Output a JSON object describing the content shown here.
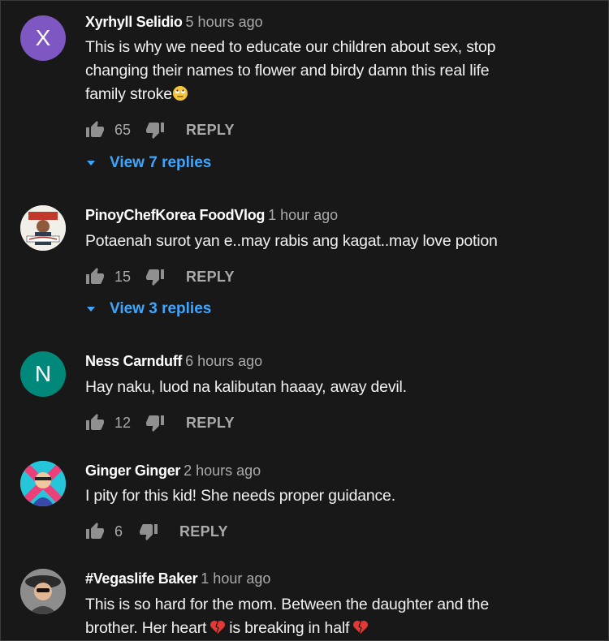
{
  "colors": {
    "background": "#181818",
    "link": "#3ea6ff",
    "meta": "#aaaaaa",
    "text": "#f1f1f1"
  },
  "reply_label": "REPLY",
  "comments": [
    {
      "author": "Xyrhyll Selidio",
      "time": "5 hours ago",
      "avatar_letter": "X",
      "avatar_color": "#7e57c2",
      "text_lines": [
        "This is why we need to educate our children about sex, stop",
        "changing their names to flower and birdy damn this real life",
        "family stroke"
      ],
      "text_end_icon": "eye-roll-emoji-icon",
      "likes": "65",
      "replies": "View 7 replies"
    },
    {
      "author": "PinoyChefKorea FoodVlog",
      "time": "1 hour ago",
      "avatar_icon": "channel-photo",
      "text_lines": [
        "Potaenah surot yan e..may rabis ang kagat..may love potion"
      ],
      "likes": "15",
      "replies": "View 3 replies"
    },
    {
      "author": "Ness Carnduff",
      "time": "6 hours ago",
      "avatar_letter": "N",
      "avatar_color": "#00897b",
      "text_lines": [
        "Hay naku, luod na kalibutan haaay, away devil."
      ],
      "likes": "12"
    },
    {
      "author": "Ginger Ginger",
      "time": "2 hours ago",
      "avatar_icon": "user-photo",
      "text_lines": [
        "I pity for this kid! She needs proper guidance."
      ],
      "likes": "6"
    },
    {
      "author": "#Vegaslife Baker",
      "time": "1 hour ago",
      "avatar_icon": "user-photo",
      "text_lines": [
        "This is so hard for the mom. Between the daughter and the",
        "brother. Her heart",
        "is breaking in half"
      ],
      "text_icons": [
        "broken-heart-icon",
        "broken-heart-icon"
      ]
    }
  ]
}
